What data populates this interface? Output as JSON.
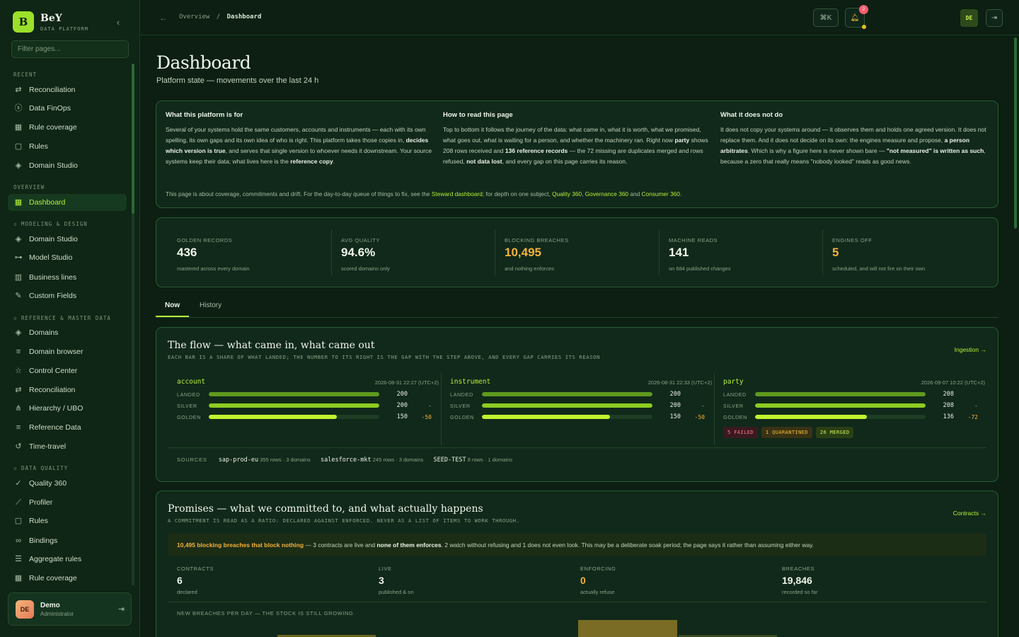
{
  "brand": {
    "logo": "B",
    "name": "BeY",
    "sub": "DATA PLATFORM"
  },
  "sidebar": {
    "filter_placeholder": "Filter pages...",
    "sections": {
      "recent": "RECENT",
      "overview": "OVERVIEW",
      "modeling": "MODELING & DESIGN",
      "reference": "REFERENCE & MASTER DATA",
      "quality": "DATA QUALITY"
    },
    "items": [
      {
        "label": "Reconciliation",
        "icon": "arrows-icon"
      },
      {
        "label": "Data FinOps",
        "icon": "dollar-circle-icon"
      },
      {
        "label": "Rule coverage",
        "icon": "grid-icon"
      },
      {
        "label": "Rules",
        "icon": "clipboard-icon"
      },
      {
        "label": "Domain Studio",
        "icon": "layers-icon"
      },
      {
        "label": "Dashboard",
        "icon": "dashboard-icon"
      },
      {
        "label": "Domain Studio",
        "icon": "layers-icon"
      },
      {
        "label": "Model Studio",
        "icon": "model-icon"
      },
      {
        "label": "Business lines",
        "icon": "bar-chart-icon"
      },
      {
        "label": "Custom Fields",
        "icon": "pencil-icon"
      },
      {
        "label": "Domains",
        "icon": "layers-icon"
      },
      {
        "label": "Domain browser",
        "icon": "list-icon"
      },
      {
        "label": "Control Center",
        "icon": "star-icon"
      },
      {
        "label": "Reconciliation",
        "icon": "arrows-icon"
      },
      {
        "label": "Hierarchy / UBO",
        "icon": "hierarchy-icon"
      },
      {
        "label": "Reference Data",
        "icon": "list-icon"
      },
      {
        "label": "Time-travel",
        "icon": "history-icon"
      },
      {
        "label": "Quality 360",
        "icon": "shield-check-icon"
      },
      {
        "label": "Profiler",
        "icon": "line-chart-icon"
      },
      {
        "label": "Rules",
        "icon": "clipboard-icon"
      },
      {
        "label": "Bindings",
        "icon": "link-icon"
      },
      {
        "label": "Aggregate rules",
        "icon": "filter-icon"
      },
      {
        "label": "Rule coverage",
        "icon": "grid-icon"
      }
    ],
    "user": {
      "initials": "DE",
      "name": "Demo",
      "role": "Administrator"
    }
  },
  "topbar": {
    "breadcrumb_root": "Overview",
    "breadcrumb_sep": "/",
    "breadcrumb_current": "Dashboard",
    "shortcut": "⌘K",
    "notifications": "2",
    "lang": "DE"
  },
  "page": {
    "title": "Dashboard",
    "subtitle": "Platform state — movements over the last 24 h"
  },
  "intro": {
    "c1_title": "What this platform is for",
    "c1_p1": "Several of your systems hold the same customers, accounts and instruments — each with its own spelling, its own gaps and its own idea of who is right. This platform takes those copies in, ",
    "c1_b1": "decides which version is true",
    "c1_p2": ", and serves that single version to whoever needs it downstream. Your source systems keep their data; what lives here is the ",
    "c1_b2": "reference copy",
    "c1_p3": ".",
    "c2_title": "How to read this page",
    "c2_p1": "Top to bottom it follows the journey of the data: what came in, what it is worth, what we promised, what goes out, what is waiting for a person, and whether the machinery ran. Right now ",
    "c2_b1": "party",
    "c2_p2": " shows 208 rows received and ",
    "c2_b2": "136 reference records",
    "c2_p3": " — the 72 missing are duplicates merged and rows refused, ",
    "c2_b3": "not data lost",
    "c2_p4": ", and every gap on this page carries its reason.",
    "c3_title": "What it does not do",
    "c3_p1": "It does not copy your systems around — it observes them and holds one agreed version. It does not replace them. And it does not decide on its own: the engines measure and propose, ",
    "c3_b1": "a person arbitrates",
    "c3_p2": ". Which is why a figure here is never shown bare — ",
    "c3_b2": "\"not measured\" is written as such",
    "c3_p3": ", because a zero that really means \"nobody looked\" reads as good news.",
    "foot_pre": "This page is about coverage, commitments and drift. For the day-to-day queue of things to fix, see the ",
    "foot_l1": "Steward dashboard",
    "foot_mid": "; for depth on one subject, ",
    "foot_l2": "Quality 360",
    "foot_c": ", ",
    "foot_l3": "Governance 360",
    "foot_and": " and ",
    "foot_l4": "Consumer 360",
    "foot_end": "."
  },
  "kpis": [
    {
      "label": "GOLDEN RECORDS",
      "value": "436",
      "note": "mastered across every domain",
      "warn": false
    },
    {
      "label": "AVG QUALITY",
      "value": "94.6%",
      "note": "scored domains only",
      "warn": false
    },
    {
      "label": "BLOCKING BREACHES",
      "value": "10,495",
      "note": "and nothing enforces",
      "warn": true
    },
    {
      "label": "MACHINE READS",
      "value": "141",
      "note": "on 684 published changes",
      "warn": false
    },
    {
      "label": "ENGINES OFF",
      "value": "5",
      "note": "scheduled, and will not fire on their own",
      "warn": true
    }
  ],
  "tabs": [
    "Now",
    "History"
  ],
  "flow": {
    "title": "The flow — what came in, what came out",
    "subtitle": "EACH BAR IS A SHARE OF WHAT LANDED; THE NUMBER TO ITS RIGHT IS THE GAP WITH THE STEP ABOVE, AND EVERY GAP CARRIES ITS REASON",
    "link": "Ingestion →",
    "row_labels": [
      "LANDED",
      "SILVER",
      "GOLDEN"
    ],
    "entities": [
      {
        "name": "account",
        "date": "2026-08-31 22:27 (UTC+2)",
        "landed": 200,
        "silver": 200,
        "golden": 150,
        "silver_delta": "-",
        "golden_delta": "-50"
      },
      {
        "name": "instrument",
        "date": "2026-08-31 22:33 (UTC+2)",
        "landed": 200,
        "silver": 200,
        "golden": 150,
        "silver_delta": "-",
        "golden_delta": "-50"
      },
      {
        "name": "party",
        "date": "2026-09-07 10:22 (UTC+2)",
        "landed": 208,
        "silver": 208,
        "golden": 136,
        "silver_delta": "-",
        "golden_delta": "-72"
      }
    ],
    "party_badges": [
      "5 FAILED",
      "1 QUARANTINED",
      "26 MERGED"
    ],
    "sources_label": "SOURCES",
    "sources": [
      {
        "name": "sap-prod-eu",
        "meta": "355 rows · 3 domains"
      },
      {
        "name": "salesforce-mkt",
        "meta": "245 rows · 3 domains"
      },
      {
        "name": "SEED-TEST",
        "meta": "8 rows · 1 domains"
      }
    ]
  },
  "promises": {
    "title": "Promises — what we committed to, and what actually happens",
    "subtitle": "A COMMITMENT IS READ AS A RATIO: DECLARED AGAINST ENFORCED. NEVER AS A LIST OF ITEMS TO WORK THROUGH.",
    "link": "Contracts →",
    "alert_hl": "10,495 blocking breaches that block nothing",
    "alert_p1": " — 3 contracts are live and ",
    "alert_b1": "none of them enforces",
    "alert_p2": ". 2 watch without refusing and 1 does not even look. This may be a deliberate soak period; the page says it rather than assuming either way.",
    "kpis": [
      {
        "label": "CONTRACTS",
        "value": "6",
        "note": "declared",
        "warn": false
      },
      {
        "label": "LIVE",
        "value": "3",
        "note": "published & on",
        "warn": false
      },
      {
        "label": "ENFORCING",
        "value": "0",
        "note": "actually refuse",
        "warn": true
      },
      {
        "label": "BREACHES",
        "value": "19,846",
        "note": "recorded so far",
        "warn": false
      }
    ],
    "chart_title": "NEW BREACHES PER DAY — THE STOCK IS STILL GROWING"
  },
  "colors": {
    "accent": "#b6f23a",
    "warn": "#f6b23a",
    "bg": "#0c1f12",
    "card": "#11291a"
  }
}
